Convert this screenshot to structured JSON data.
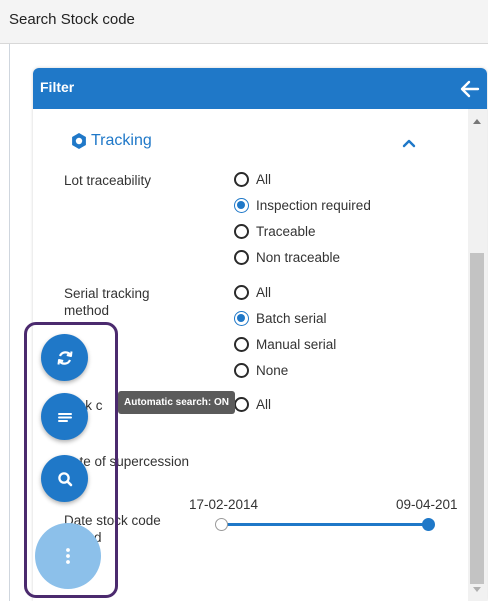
{
  "window": {
    "title": "Search Stock code"
  },
  "filter": {
    "title": "Filter",
    "section": {
      "title": "Tracking"
    },
    "lot_traceability": {
      "label": "Lot traceability",
      "options": [
        "All",
        "Inspection required",
        "Traceable",
        "Non traceable"
      ],
      "selected": "Inspection required"
    },
    "serial_tracking": {
      "label": "Serial tracking method",
      "options": [
        "All",
        "Batch serial",
        "Manual serial",
        "None"
      ],
      "selected": "Batch serial"
    },
    "stock_code": {
      "label_visible": "ock c",
      "options": [
        "All"
      ]
    },
    "supercession": {
      "label_visible": "ate of supercession"
    },
    "date_added": {
      "label": "Date stock code added",
      "range_start": "17-02-2014",
      "range_end": "09-04-201"
    }
  },
  "tooltip": {
    "text": "Automatic search: ON"
  },
  "fabs": [
    {
      "name": "refresh",
      "icon": "refresh-icon"
    },
    {
      "name": "list",
      "icon": "list-icon"
    },
    {
      "name": "search",
      "icon": "search-icon"
    },
    {
      "name": "more",
      "icon": "more-vertical-icon"
    }
  ],
  "colors": {
    "accent": "#1f78c8",
    "fab_main": "#8cc0ea",
    "highlight": "#4b2a6e",
    "tooltip": "#5b5b5b"
  }
}
